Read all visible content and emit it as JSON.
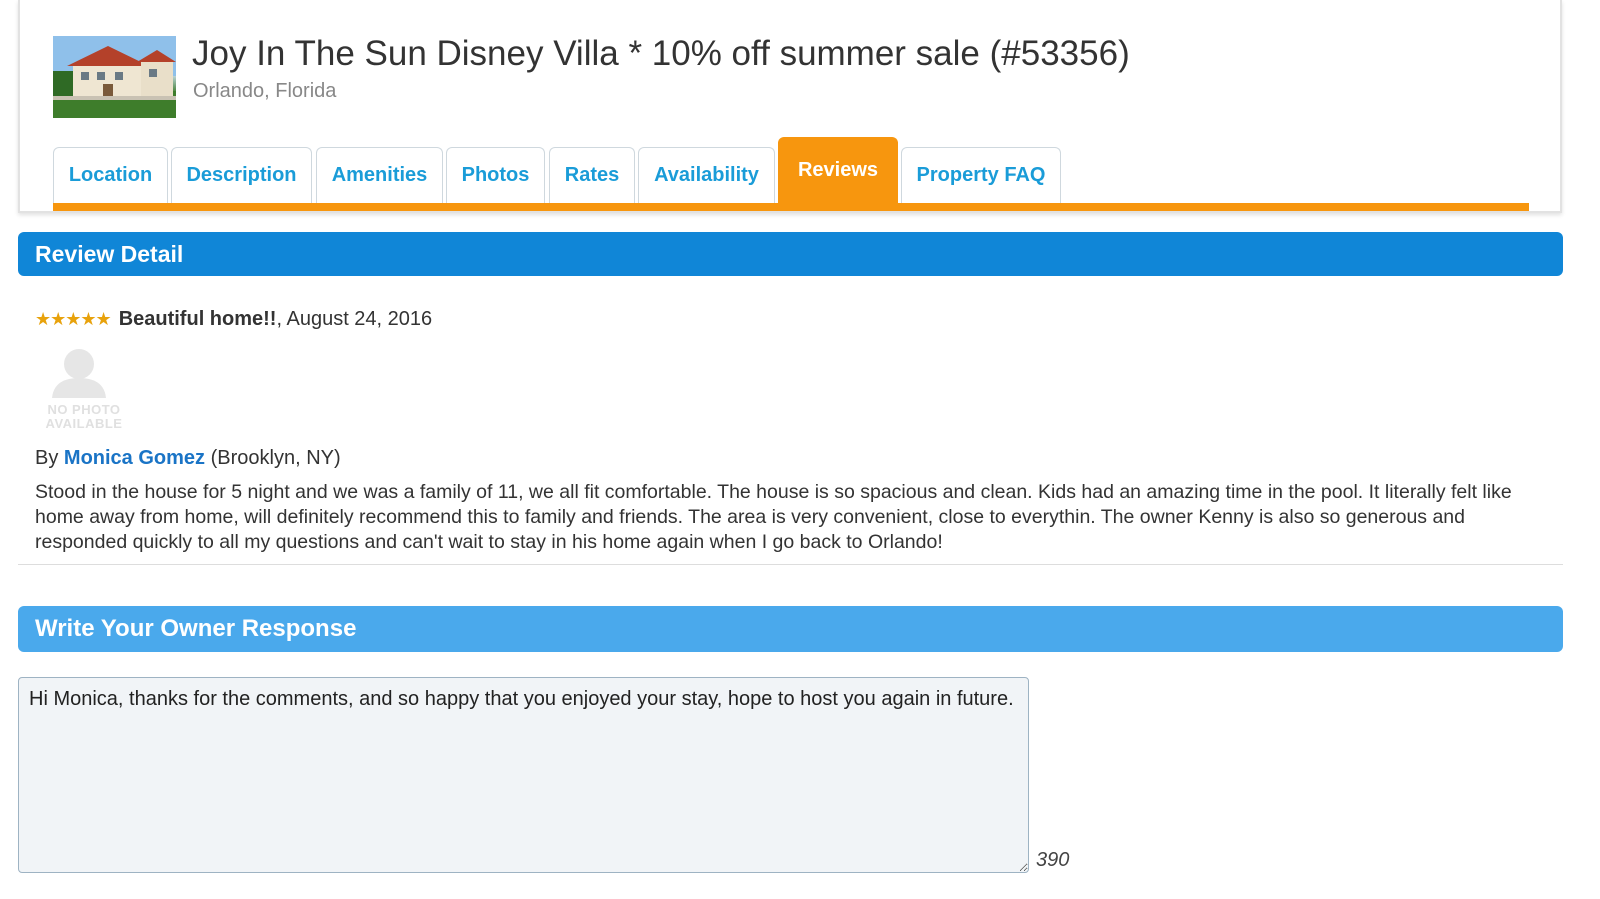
{
  "listing": {
    "title": "Joy In The Sun Disney Villa * 10% off summer sale (#53356)",
    "location": "Orlando, Florida"
  },
  "tabs": [
    {
      "label": "Location"
    },
    {
      "label": "Description"
    },
    {
      "label": "Amenities"
    },
    {
      "label": "Photos"
    },
    {
      "label": "Rates"
    },
    {
      "label": "Availability"
    },
    {
      "label": "Reviews",
      "active": true
    },
    {
      "label": "Property FAQ"
    }
  ],
  "review_detail": {
    "heading": "Review Detail",
    "rating": 5,
    "rating_stars": "★★★★★",
    "title": "Beautiful home!!",
    "date": ", August 24, 2016",
    "no_photo_line1": "NO PHOTO",
    "no_photo_line2": "AVAILABLE",
    "by_prefix": "By ",
    "reviewer_name": "Monica Gomez",
    "reviewer_location": " (Brooklyn, NY)",
    "body": "Stood in the house for 5 night and we was a family of 11, we all fit comfortable. The house is so spacious and clean. Kids had an amazing time in the pool. It literally felt like home away from home, will definitely recommend this to family and friends. The area is very convenient, close to everythin. The owner Kenny is also so generous and responded quickly to all my questions and can't wait to stay in his home again when I go back to Orlando!"
  },
  "owner_response": {
    "heading": "Write Your Owner Response",
    "value": "Hi Monica, thanks for the comments, and so happy that you enjoyed your stay, hope to host you again in future.",
    "chars_remaining": "390"
  },
  "colors": {
    "accent_orange": "#f7960e",
    "detail_bar": "#1086d7",
    "response_bar": "#4aa9ec",
    "tab_text": "#1a9cd8",
    "link": "#1a74c6"
  }
}
